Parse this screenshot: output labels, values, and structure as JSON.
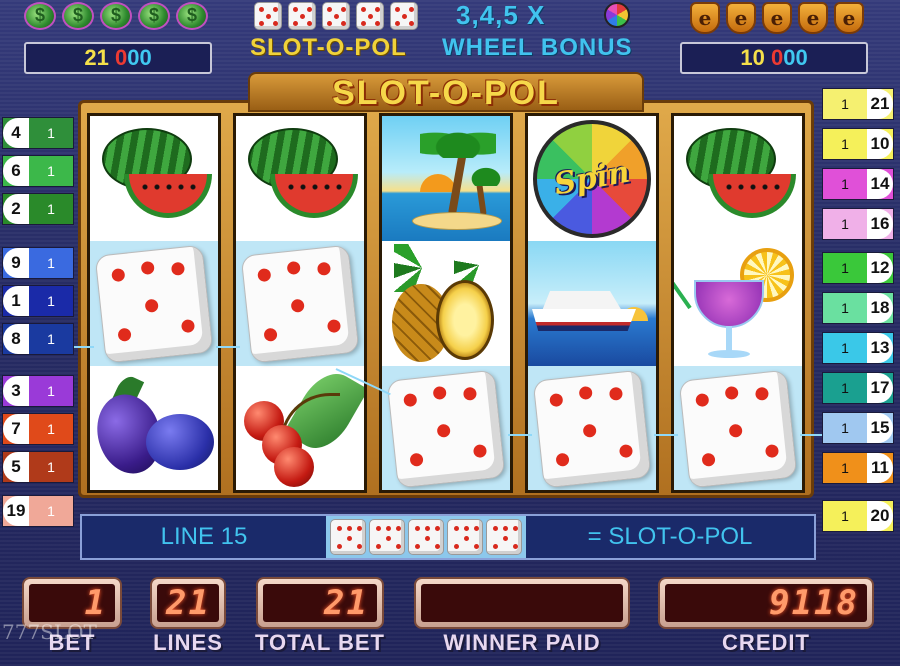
{
  "header": {
    "title_left": "SLOT-O-POL",
    "title_right": "WHEEL BONUS",
    "multiplier_text": "3,4,5 X",
    "left_jackpot": [
      "2",
      "1",
      "0",
      "0",
      "0"
    ],
    "right_jackpot": [
      "1",
      "0",
      "0",
      "0",
      "0"
    ],
    "money_icons": [
      "money-icon",
      "money-icon",
      "money-icon",
      "money-icon",
      "money-icon"
    ],
    "dice_icons": [
      "dice-icon",
      "dice-icon",
      "dice-icon",
      "dice-icon",
      "dice-icon"
    ],
    "shield_icons": [
      "shield-e-icon",
      "shield-e-icon",
      "shield-e-icon",
      "shield-e-icon",
      "shield-e-icon"
    ]
  },
  "machine": {
    "logo": "SLOT-O-POL",
    "spin_symbol_text": "Spin",
    "reels": [
      [
        "watermelon",
        "dice",
        "plum"
      ],
      [
        "watermelon",
        "dice",
        "cherry"
      ],
      [
        "palm-island",
        "pineapple",
        "dice"
      ],
      [
        "spin-wheel",
        "cruise-ship",
        "dice"
      ],
      [
        "watermelon",
        "cocktail",
        "dice"
      ]
    ]
  },
  "lines_left": [
    {
      "num": "4",
      "bet": "1",
      "color": "#2f8f3a"
    },
    {
      "num": "6",
      "bet": "1",
      "color": "#3cb84a"
    },
    {
      "num": "2",
      "bet": "1",
      "color": "#2a8a2a"
    },
    {
      "num": "9",
      "bet": "1",
      "color": "#3a6ae0"
    },
    {
      "num": "1",
      "bet": "1",
      "color": "#1a2aa8"
    },
    {
      "num": "8",
      "bet": "1",
      "color": "#1a3aa0"
    },
    {
      "num": "3",
      "bet": "1",
      "color": "#9a3ad8"
    },
    {
      "num": "7",
      "bet": "1",
      "color": "#e04a1a"
    },
    {
      "num": "5",
      "bet": "1",
      "color": "#b03a1a"
    },
    {
      "num": "19",
      "bet": "1",
      "color": "#f0a898"
    }
  ],
  "lines_right": [
    {
      "num": "21",
      "bet": "1",
      "color": "#f5f070"
    },
    {
      "num": "10",
      "bet": "1",
      "color": "#f5f05a"
    },
    {
      "num": "14",
      "bet": "1",
      "color": "#e050d8"
    },
    {
      "num": "16",
      "bet": "1",
      "color": "#f0b0e8"
    },
    {
      "num": "12",
      "bet": "1",
      "color": "#3ac83a"
    },
    {
      "num": "18",
      "bet": "1",
      "color": "#6ae0a0"
    },
    {
      "num": "13",
      "bet": "1",
      "color": "#3ac8e8"
    },
    {
      "num": "17",
      "bet": "1",
      "color": "#1aa090"
    },
    {
      "num": "15",
      "bet": "1",
      "color": "#a0c8f0"
    },
    {
      "num": "11",
      "bet": "1",
      "color": "#f0901a"
    },
    {
      "num": "20",
      "bet": "1",
      "color": "#f5f05a"
    }
  ],
  "status": {
    "line_label": "LINE 15",
    "result_text": "= SLOT-O-POL"
  },
  "meters": {
    "bet": {
      "value": "1",
      "label": "BET"
    },
    "lines": {
      "value": "21",
      "label": "LINES"
    },
    "total_bet": {
      "value": "21",
      "label": "TOTAL BET"
    },
    "winner_paid": {
      "value": "",
      "label": "WINNER PAID"
    },
    "credit": {
      "value": "9118",
      "label": "CREDIT"
    }
  },
  "watermark": "777SLOT",
  "colors": {
    "accent_yellow": "#f0d23a",
    "accent_cyan": "#41c3ee",
    "led_red": "#ff9a6a"
  }
}
